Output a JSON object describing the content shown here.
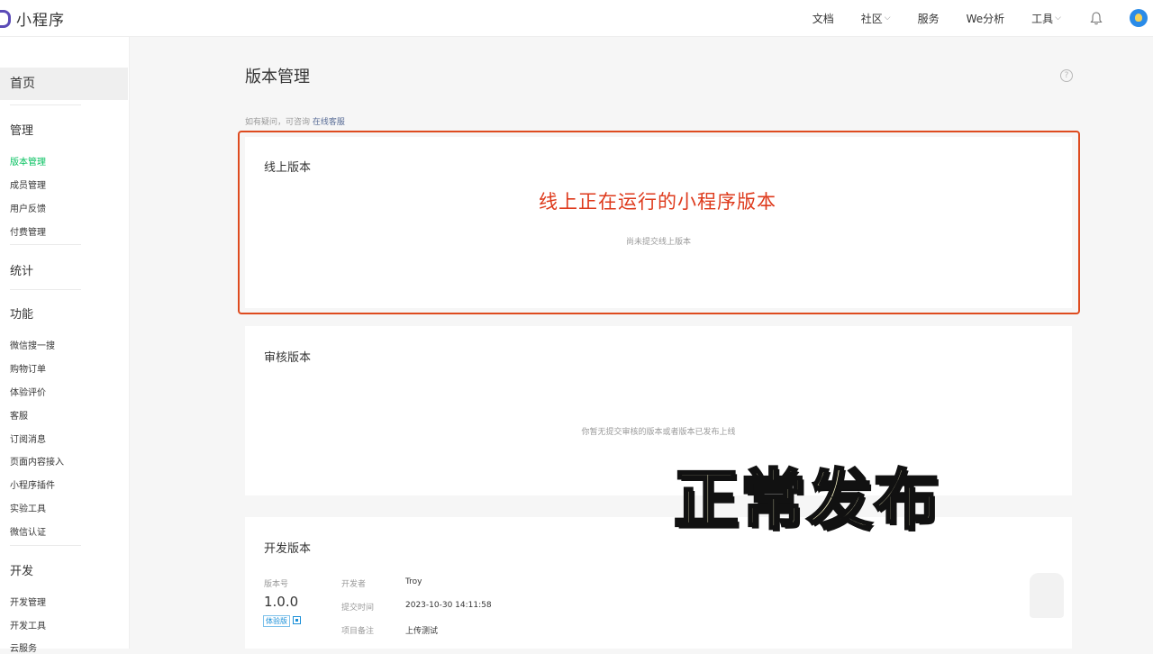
{
  "app": {
    "title": "小程序"
  },
  "nav": {
    "docs": "文档",
    "community": "社区",
    "service": "服务",
    "analytics": "We分析",
    "tools": "工具"
  },
  "sidebar": {
    "home": "首页",
    "manage_heading": "管理",
    "manage_items": [
      "版本管理",
      "成员管理",
      "用户反馈",
      "付费管理"
    ],
    "stats_heading": "统计",
    "feature_heading": "功能",
    "feature_items": [
      "微信搜一搜",
      "购物订单",
      "体验评价",
      "客服",
      "订阅消息",
      "页面内容接入",
      "小程序插件",
      "实验工具",
      "微信认证"
    ],
    "dev_heading": "开发",
    "dev_items": [
      "开发管理",
      "开发工具",
      "云服务"
    ]
  },
  "page": {
    "title": "版本管理",
    "hint_prefix": "如有疑问，可咨询",
    "hint_link": "在线客服"
  },
  "online": {
    "title": "线上版本",
    "annotation": "线上正在运行的小程序版本",
    "empty": "尚未提交线上版本"
  },
  "review": {
    "title": "审核版本",
    "empty": "你暂无提交审核的版本或者版本已发布上线"
  },
  "dev": {
    "title": "开发版本",
    "version_label": "版本号",
    "version": "1.0.0",
    "badge": "体验版",
    "developer_label": "开发者",
    "developer": "Troy",
    "submit_time_label": "提交时间",
    "submit_time": "2023-10-30 14:11:58",
    "remark_label": "项目备注",
    "remark": "上传测试"
  },
  "overlay": {
    "caption": "正常发布"
  },
  "colors": {
    "accent_green": "#07c160",
    "annotation_red": "#de3a1c",
    "link_blue": "#576b95"
  }
}
